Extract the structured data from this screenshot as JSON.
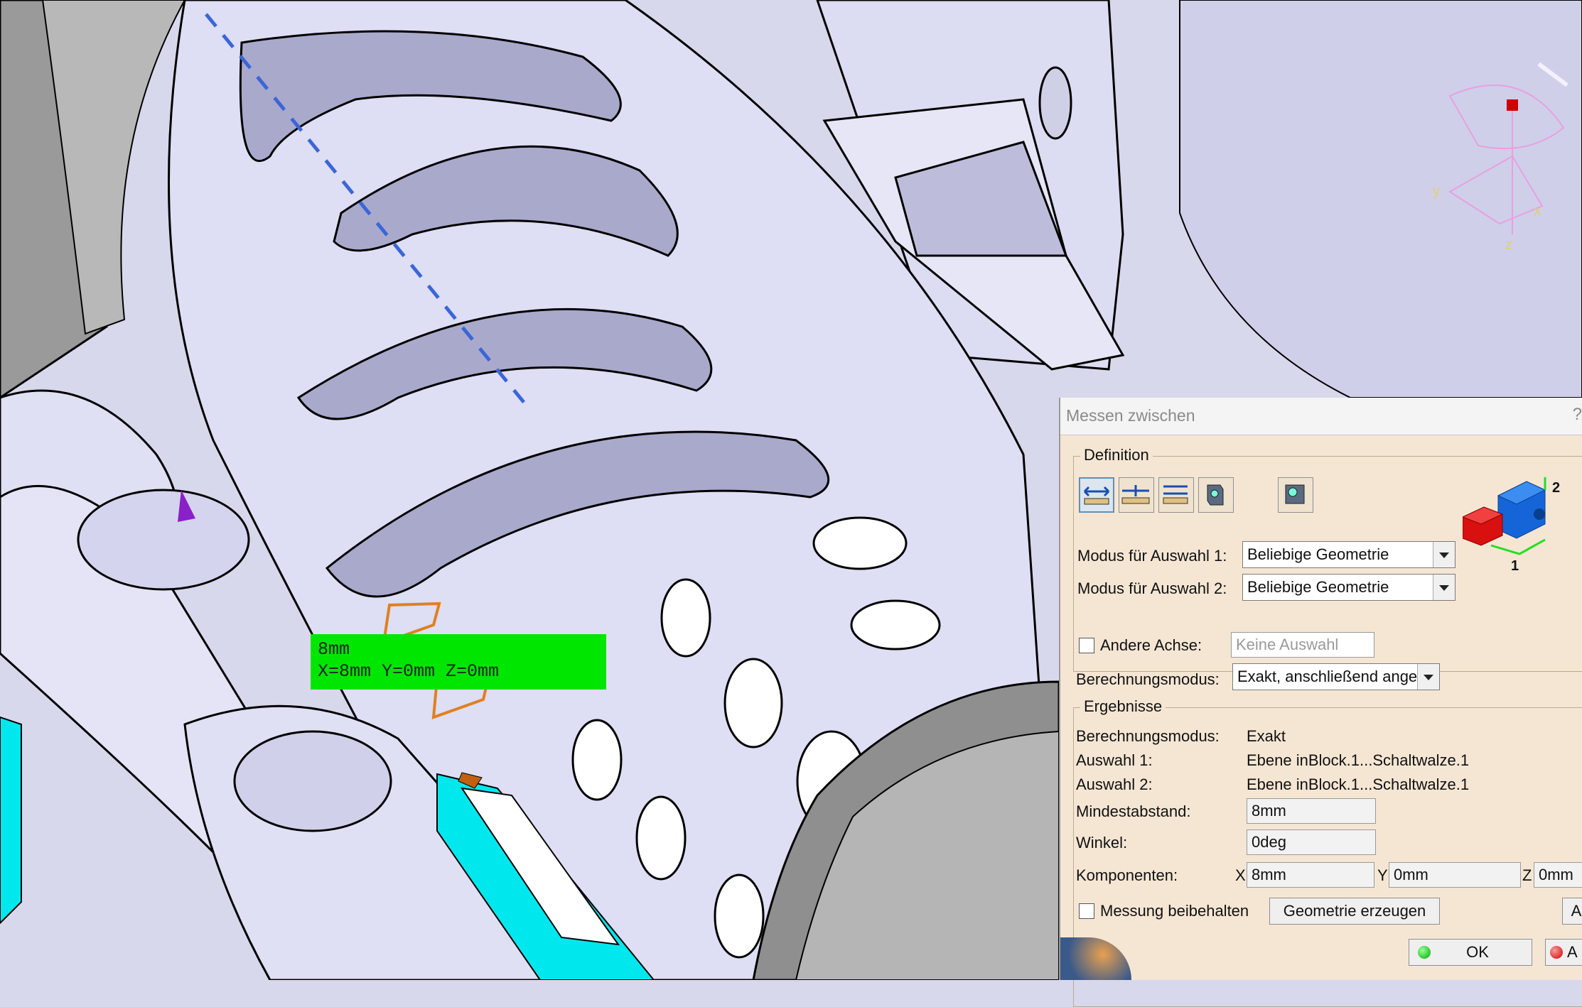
{
  "viewport": {
    "measure_label": {
      "line1": "8mm",
      "line2": "X=8mm  Y=0mm  Z=0mm"
    },
    "axis_labels": {
      "x": "x",
      "y": "y",
      "z": "z"
    }
  },
  "dialog": {
    "title": "Messen zwischen",
    "help": "?",
    "definition": {
      "label": "Definition",
      "mode1_label": "Modus für Auswahl 1:",
      "mode1_value": "Beliebige Geometrie",
      "mode2_label": "Modus für Auswahl 2:",
      "mode2_value": "Beliebige Geometrie",
      "other_axis_label": "Andere Achse:",
      "other_axis_placeholder": "Keine Auswahl",
      "calc_mode_label": "Berechnungsmodus:",
      "calc_mode_value": "Exakt, anschließend ange",
      "preview_markers": {
        "a": "1",
        "b": "2"
      }
    },
    "results": {
      "label": "Ergebnisse",
      "calc_mode_label": "Berechnungsmodus:",
      "calc_mode_value": "Exakt",
      "sel1_label": "Auswahl 1:",
      "sel1_value": "Ebene inBlock.1...Schaltwalze.1",
      "sel2_label": "Auswahl 2:",
      "sel2_value": "Ebene inBlock.1...Schaltwalze.1",
      "min_dist_label": "Mindestabstand:",
      "min_dist_value": "8mm",
      "angle_label": "Winkel:",
      "angle_value": "0deg",
      "components_label": "Komponenten:",
      "x_label": "X",
      "x_value": "8mm",
      "y_label": "Y",
      "y_value": "0mm",
      "z_label": "Z",
      "z_value": "0mm"
    },
    "keep_measure_label": "Messung beibehalten",
    "create_geometry_label": "Geometrie erzeugen",
    "apply_partial": "A",
    "ok_label": "OK",
    "cancel_partial": "A"
  },
  "colors": {
    "measure_label_bg": "#00e600",
    "part_fill": "#d8d8ee",
    "dialog_bg": "#f5e6d4",
    "cyan_part": "#00e8ee"
  }
}
